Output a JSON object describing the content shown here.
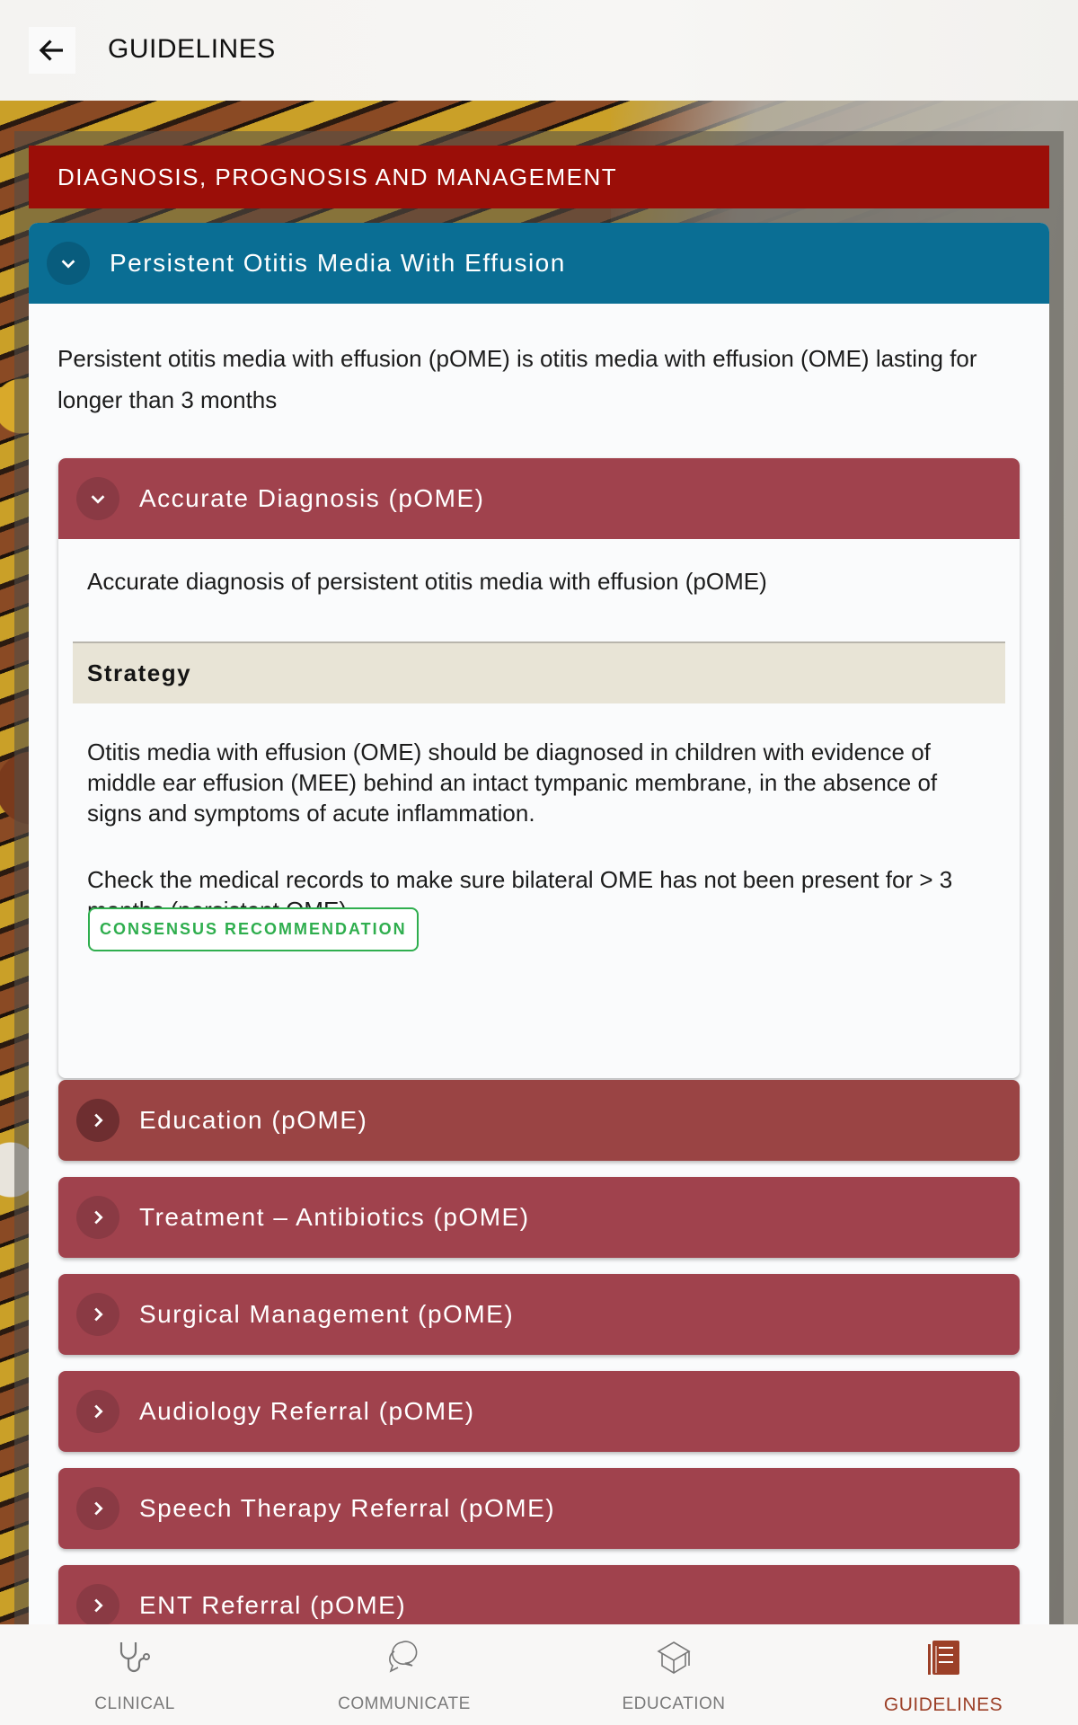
{
  "topbar": {
    "back_icon": "arrow-left-icon",
    "title": "GUIDELINES"
  },
  "section": {
    "title": "DIAGNOSIS, PROGNOSIS AND MANAGEMENT"
  },
  "topic": {
    "title": "Persistent Otitis Media With Effusion",
    "expanded": true,
    "intro": "Persistent otitis media with effusion (pOME) is otitis media with effusion (OME) lasting for longer than 3 months"
  },
  "subsections": [
    {
      "title": "Accurate Diagnosis (pOME)",
      "expanded": true,
      "description": "Accurate diagnosis of persistent otitis media with effusion (pOME)",
      "strategy_label": "Strategy",
      "strategy_paragraphs": [
        "Otitis media with effusion (OME) should be diagnosed in children with evidence of middle ear effusion (MEE) behind an intact tympanic membrane, in the absence of signs and symptoms of acute inflammation.",
        "Check the medical records to make sure bilateral OME has not been present for > 3 months (persistent OME)"
      ],
      "badge": "CONSENSUS RECOMMENDATION"
    },
    {
      "title": "Education (pOME)",
      "expanded": false
    },
    {
      "title": "Treatment – Antibiotics (pOME)",
      "expanded": false
    },
    {
      "title": "Surgical Management (pOME)",
      "expanded": false
    },
    {
      "title": "Audiology Referral (pOME)",
      "expanded": false
    },
    {
      "title": "Speech Therapy Referral (pOME)",
      "expanded": false
    },
    {
      "title": "ENT Referral (pOME)",
      "expanded": false
    }
  ],
  "bottom_nav": {
    "items": [
      {
        "label": "CLINICAL",
        "icon": "stethoscope-icon",
        "active": false
      },
      {
        "label": "COMMUNICATE",
        "icon": "chat-bubbles-icon",
        "active": false
      },
      {
        "label": "EDUCATION",
        "icon": "graduation-cap-icon",
        "active": false
      },
      {
        "label": "GUIDELINES",
        "icon": "book-icon",
        "active": true
      }
    ]
  },
  "colors": {
    "section_header": "#9b0e08",
    "topic_header": "#0a6e94",
    "subsection_header": "#a0424d",
    "badge": "#2fae4e",
    "nav_active": "#9c4028"
  }
}
